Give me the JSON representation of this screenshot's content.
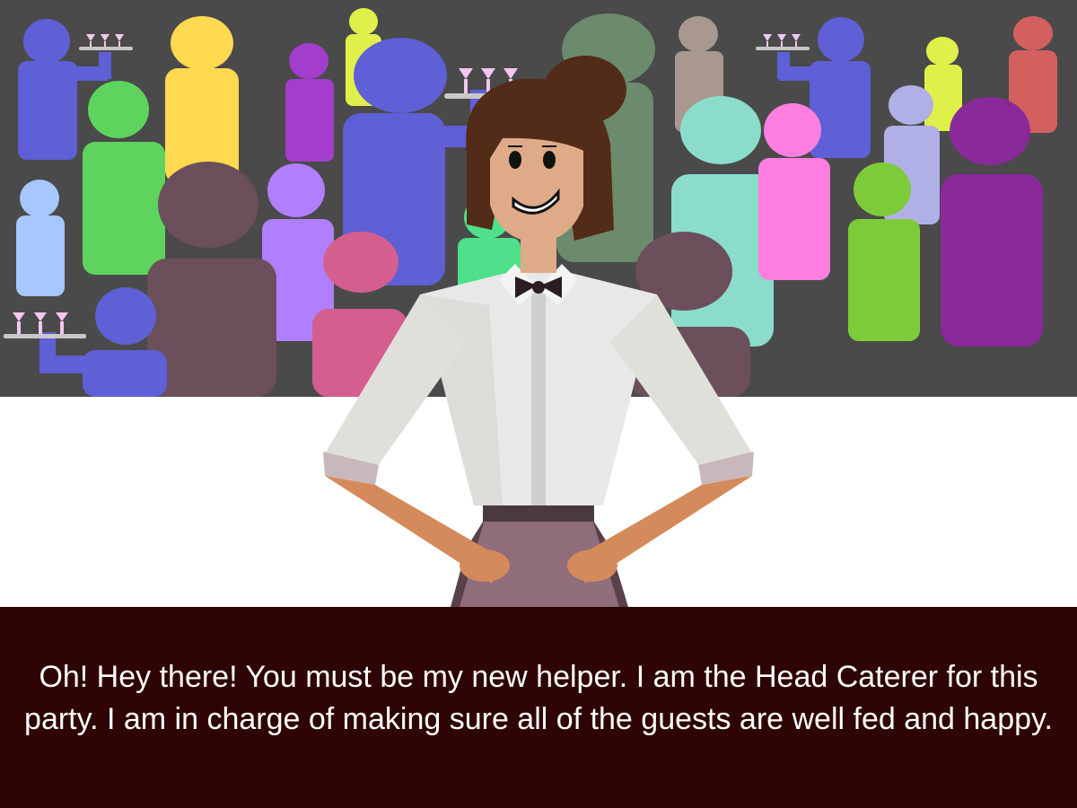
{
  "scene": {
    "background_color": "#4a4a4a",
    "floor_color": "#ffffff",
    "character": "head-caterer",
    "guest_colors": [
      "#5f5fd6",
      "#ffd94f",
      "#a23ecb",
      "#e0f04a",
      "#6c8a6c",
      "#a89890",
      "#d45f5f",
      "#5ed45e",
      "#a6c7ff",
      "#8bdccb",
      "#ff7fe0",
      "#6b4f5a",
      "#b07fff",
      "#d45f8f",
      "#4ee08a",
      "#7ecb3a",
      "#b0b0e6",
      "#8a2a9a"
    ]
  },
  "dialog": {
    "text": "Oh! Hey there! You must be my new helper. I am the Head Caterer for this party. I am in charge of making sure all of the guests are well fed and happy.",
    "background_color": "#2e0404",
    "text_color": "#ffffff"
  }
}
